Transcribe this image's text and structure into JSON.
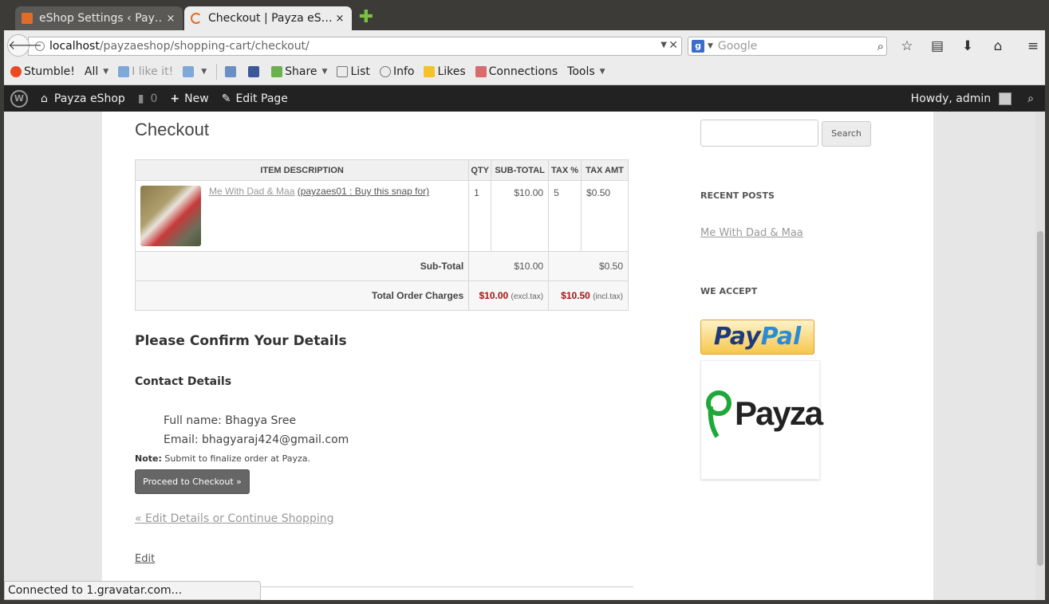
{
  "browser": {
    "tabs": [
      {
        "label": "eShop Settings ‹ Pay…",
        "close": "×"
      },
      {
        "label": "Checkout | Payza eS…",
        "close": "×"
      }
    ],
    "new_tab": "✚",
    "url_host": "localhost",
    "url_path": "/payzaeshop/shopping-cart/checkout/",
    "search_placeholder": "Google",
    "status_text": "Connected to 1.gravatar.com..."
  },
  "toolbar": {
    "stumble": "Stumble!",
    "all": "All",
    "like": "I like it!",
    "share": "Share",
    "list": "List",
    "info": "Info",
    "likes": "Likes",
    "connections": "Connections",
    "tools": "Tools"
  },
  "adminbar": {
    "site": "Payza eShop",
    "comments": "0",
    "new": "New",
    "edit": "Edit Page",
    "howdy": "Howdy, admin"
  },
  "page": {
    "title": "Checkout",
    "table": {
      "headers": [
        "ITEM DESCRIPTION",
        "QTY",
        "SUB-TOTAL",
        "TAX %",
        "TAX AMT"
      ],
      "item_name": "Me With Dad & Maa",
      "item_code": "(payzaes01 : Buy this snap for)",
      "qty": "1",
      "subtotal": "$10.00",
      "tax_pct": "5",
      "tax_amt": "$0.50",
      "sub_label": "Sub-Total",
      "sub_subtotal": "$10.00",
      "sub_tax": "$0.50",
      "total_label": "Total Order Charges",
      "total_excl": "$10.00",
      "excl_note": "(excl.tax)",
      "total_incl": "$10.50",
      "incl_note": "(incl.tax)"
    },
    "confirm_heading": "Please Confirm Your Details",
    "contact_heading": "Contact Details",
    "full_name": "Full name: Bhagya Sree",
    "email": "Email: bhagyaraj424@gmail.com",
    "note_label": "Note:",
    "note_text": "Submit to finalize order at Payza.",
    "checkout_button": "Proceed to Checkout »",
    "edit_details": "« Edit Details or Continue Shopping",
    "edit_page": "Edit"
  },
  "sidebar": {
    "search_button": "Search",
    "recent_posts_title": "RECENT POSTS",
    "recent_post": "Me With Dad & Maa",
    "we_accept_title": "WE ACCEPT",
    "paypal_1": "Pay",
    "paypal_2": "Pal",
    "payza": "Payza"
  }
}
